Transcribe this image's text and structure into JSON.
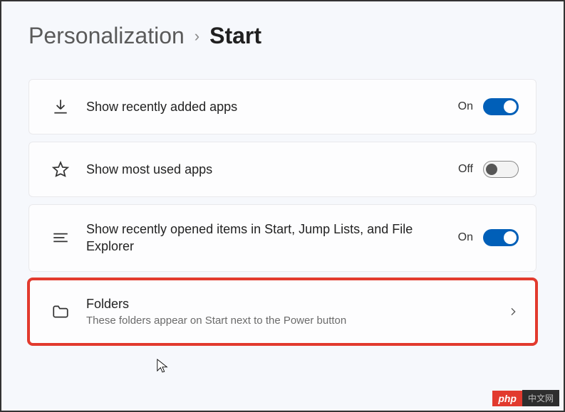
{
  "breadcrumb": {
    "parent": "Personalization",
    "current": "Start"
  },
  "rows": {
    "recent_apps": {
      "label": "Show recently added apps",
      "state": "On"
    },
    "most_used": {
      "label": "Show most used apps",
      "state": "Off"
    },
    "recent_items": {
      "label": "Show recently opened items in Start, Jump Lists, and File Explorer",
      "state": "On"
    },
    "folders": {
      "label": "Folders",
      "desc": "These folders appear on Start next to the Power button"
    }
  },
  "badge": {
    "left": "php",
    "right": "中文网"
  }
}
